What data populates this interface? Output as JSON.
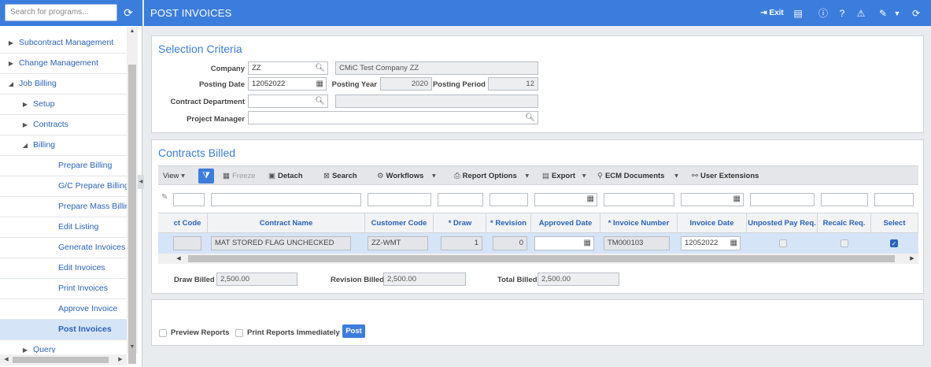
{
  "sidebar": {
    "search_placeholder": "Search for programs...",
    "items": [
      {
        "label": "Subcontract Management",
        "arrow": "▶"
      },
      {
        "label": "Change Management",
        "arrow": "▶"
      },
      {
        "label": "Job Billing",
        "arrow": "◢"
      },
      {
        "label": "Setup",
        "arrow": "▶"
      },
      {
        "label": "Contracts",
        "arrow": "▶"
      },
      {
        "label": "Billing",
        "arrow": "◢"
      },
      {
        "label": "Prepare Billing",
        "arrow": ""
      },
      {
        "label": "G/C Prepare Billing",
        "arrow": ""
      },
      {
        "label": "Prepare Mass Billing",
        "arrow": ""
      },
      {
        "label": "Edit Listing",
        "arrow": ""
      },
      {
        "label": "Generate Invoices",
        "arrow": ""
      },
      {
        "label": "Edit Invoices",
        "arrow": ""
      },
      {
        "label": "Print Invoices",
        "arrow": ""
      },
      {
        "label": "Approve Invoice",
        "arrow": ""
      },
      {
        "label": "Post Invoices",
        "arrow": ""
      },
      {
        "label": "Query",
        "arrow": "▶"
      }
    ]
  },
  "header": {
    "title": "POST INVOICES",
    "exit_label": "Exit"
  },
  "selection": {
    "title": "Selection Criteria",
    "company_label": "Company",
    "company_value": "ZZ",
    "company_name": "CMiC Test Company ZZ",
    "posting_date_label": "Posting Date",
    "posting_date_value": "12052022",
    "posting_year_label": "Posting Year",
    "posting_year_value": "2020",
    "posting_period_label": "Posting Period",
    "posting_period_value": "12",
    "contract_dept_label": "Contract Department",
    "contract_dept_value": "",
    "contract_dept_name": "",
    "project_manager_label": "Project Manager",
    "project_manager_value": ""
  },
  "contracts": {
    "title": "Contracts Billed",
    "toolbar": {
      "view": "View",
      "freeze": "Freeze",
      "detach": "Detach",
      "search": "Search",
      "workflows": "Workflows",
      "report_options": "Report Options",
      "export": "Export",
      "ecm_documents": "ECM Documents",
      "user_extensions": "User Extensions"
    },
    "columns": [
      "ct Code",
      "Contract Name",
      "Customer Code",
      "* Draw",
      "* Revision",
      "Approved Date",
      "* Invoice Number",
      "Invoice Date",
      "Unposted Pay Req.",
      "Recalc Req.",
      "Select"
    ],
    "row": {
      "ct_code": "",
      "contract_name": "MAT STORED FLAG UNCHECKED",
      "customer_code": "ZZ-WMT",
      "draw": "1",
      "revision": "0",
      "approved_date": "",
      "invoice_number": "TM000103",
      "invoice_date": "12052022",
      "unposted_pay_req": false,
      "recalc_req": false,
      "select": true
    },
    "totals": {
      "draw_billed_label": "Draw Billed",
      "draw_billed_value": "2,500.00",
      "revision_billed_label": "Revision Billed",
      "revision_billed_value": "2,500.00",
      "total_billed_label": "Total Billed",
      "total_billed_value": "2,500.00"
    }
  },
  "footer": {
    "preview_reports_label": "Preview Reports",
    "print_immediately_label": "Print Reports Immediately",
    "post_label": "Post"
  },
  "colors": {
    "accent": "#3b7ddd",
    "selected_row": "#d5e4f7",
    "link": "#2a63b8"
  }
}
